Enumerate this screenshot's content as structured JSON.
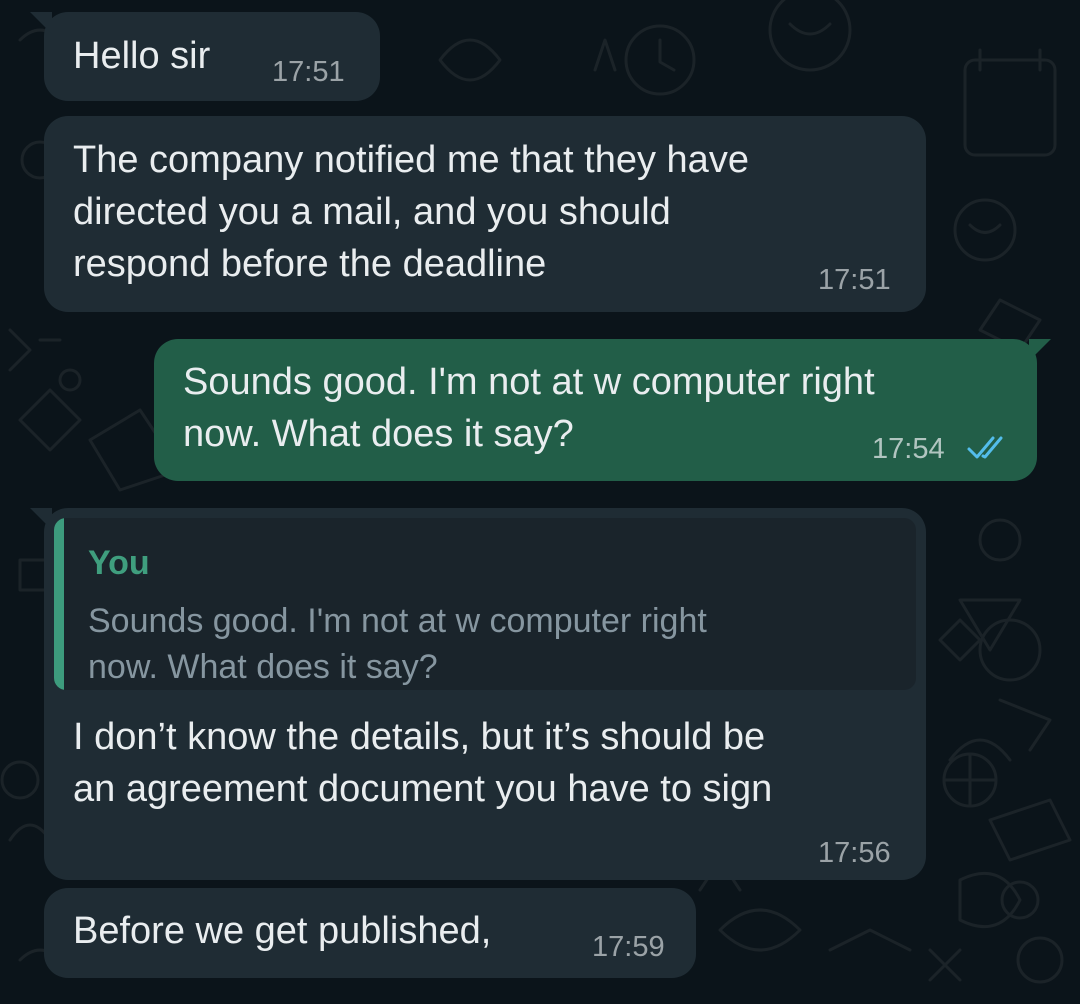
{
  "messages": [
    {
      "direction": "incoming",
      "lines": [
        "Hello sir"
      ],
      "time": "17:51"
    },
    {
      "direction": "incoming",
      "lines": [
        "The company notified me that they have",
        "directed you a mail, and you should",
        "respond before the deadline"
      ],
      "time": "17:51"
    },
    {
      "direction": "outgoing",
      "lines": [
        "Sounds good. I'm not at w computer right",
        "now. What does it say?"
      ],
      "time": "17:54",
      "status_icon": "double-check-read-icon"
    },
    {
      "direction": "incoming",
      "quote": {
        "author": "You",
        "lines": [
          "Sounds good. I'm not at w computer right",
          "now. What does it say?"
        ]
      },
      "lines": [
        "I don’t know the details, but it’s should be",
        "an agreement document you have to sign"
      ],
      "time": "17:56"
    },
    {
      "direction": "incoming",
      "lines": [
        "Before we get published,"
      ],
      "time": "17:59"
    }
  ],
  "colors": {
    "background": "#0b141a",
    "incoming_bubble": "#1f2c34",
    "outgoing_bubble": "#225e48",
    "quote_accent": "#3d9b7d",
    "read_ticks": "#53bdeb"
  }
}
